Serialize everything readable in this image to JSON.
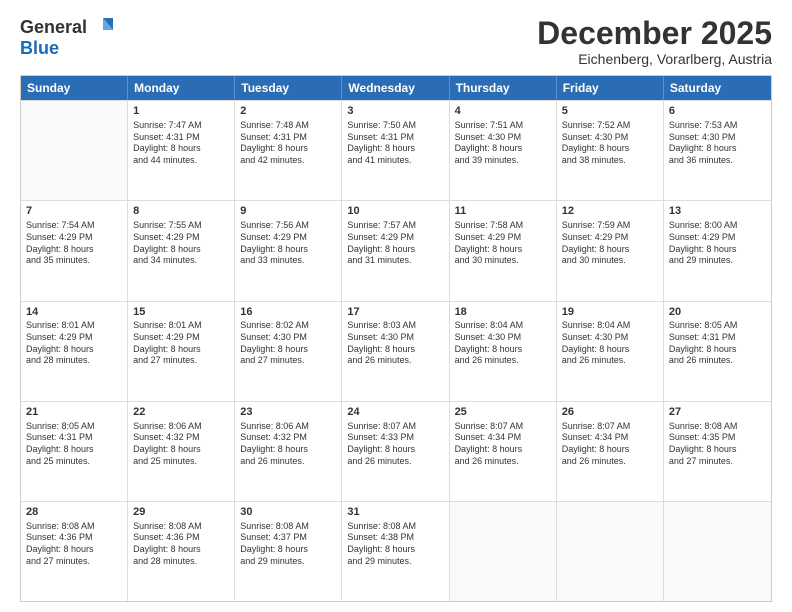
{
  "logo": {
    "general": "General",
    "blue": "Blue"
  },
  "title": "December 2025",
  "subtitle": "Eichenberg, Vorarlberg, Austria",
  "header_days": [
    "Sunday",
    "Monday",
    "Tuesday",
    "Wednesday",
    "Thursday",
    "Friday",
    "Saturday"
  ],
  "weeks": [
    [
      {
        "day": "",
        "lines": []
      },
      {
        "day": "1",
        "lines": [
          "Sunrise: 7:47 AM",
          "Sunset: 4:31 PM",
          "Daylight: 8 hours",
          "and 44 minutes."
        ]
      },
      {
        "day": "2",
        "lines": [
          "Sunrise: 7:48 AM",
          "Sunset: 4:31 PM",
          "Daylight: 8 hours",
          "and 42 minutes."
        ]
      },
      {
        "day": "3",
        "lines": [
          "Sunrise: 7:50 AM",
          "Sunset: 4:31 PM",
          "Daylight: 8 hours",
          "and 41 minutes."
        ]
      },
      {
        "day": "4",
        "lines": [
          "Sunrise: 7:51 AM",
          "Sunset: 4:30 PM",
          "Daylight: 8 hours",
          "and 39 minutes."
        ]
      },
      {
        "day": "5",
        "lines": [
          "Sunrise: 7:52 AM",
          "Sunset: 4:30 PM",
          "Daylight: 8 hours",
          "and 38 minutes."
        ]
      },
      {
        "day": "6",
        "lines": [
          "Sunrise: 7:53 AM",
          "Sunset: 4:30 PM",
          "Daylight: 8 hours",
          "and 36 minutes."
        ]
      }
    ],
    [
      {
        "day": "7",
        "lines": [
          "Sunrise: 7:54 AM",
          "Sunset: 4:29 PM",
          "Daylight: 8 hours",
          "and 35 minutes."
        ]
      },
      {
        "day": "8",
        "lines": [
          "Sunrise: 7:55 AM",
          "Sunset: 4:29 PM",
          "Daylight: 8 hours",
          "and 34 minutes."
        ]
      },
      {
        "day": "9",
        "lines": [
          "Sunrise: 7:56 AM",
          "Sunset: 4:29 PM",
          "Daylight: 8 hours",
          "and 33 minutes."
        ]
      },
      {
        "day": "10",
        "lines": [
          "Sunrise: 7:57 AM",
          "Sunset: 4:29 PM",
          "Daylight: 8 hours",
          "and 31 minutes."
        ]
      },
      {
        "day": "11",
        "lines": [
          "Sunrise: 7:58 AM",
          "Sunset: 4:29 PM",
          "Daylight: 8 hours",
          "and 30 minutes."
        ]
      },
      {
        "day": "12",
        "lines": [
          "Sunrise: 7:59 AM",
          "Sunset: 4:29 PM",
          "Daylight: 8 hours",
          "and 30 minutes."
        ]
      },
      {
        "day": "13",
        "lines": [
          "Sunrise: 8:00 AM",
          "Sunset: 4:29 PM",
          "Daylight: 8 hours",
          "and 29 minutes."
        ]
      }
    ],
    [
      {
        "day": "14",
        "lines": [
          "Sunrise: 8:01 AM",
          "Sunset: 4:29 PM",
          "Daylight: 8 hours",
          "and 28 minutes."
        ]
      },
      {
        "day": "15",
        "lines": [
          "Sunrise: 8:01 AM",
          "Sunset: 4:29 PM",
          "Daylight: 8 hours",
          "and 27 minutes."
        ]
      },
      {
        "day": "16",
        "lines": [
          "Sunrise: 8:02 AM",
          "Sunset: 4:30 PM",
          "Daylight: 8 hours",
          "and 27 minutes."
        ]
      },
      {
        "day": "17",
        "lines": [
          "Sunrise: 8:03 AM",
          "Sunset: 4:30 PM",
          "Daylight: 8 hours",
          "and 26 minutes."
        ]
      },
      {
        "day": "18",
        "lines": [
          "Sunrise: 8:04 AM",
          "Sunset: 4:30 PM",
          "Daylight: 8 hours",
          "and 26 minutes."
        ]
      },
      {
        "day": "19",
        "lines": [
          "Sunrise: 8:04 AM",
          "Sunset: 4:30 PM",
          "Daylight: 8 hours",
          "and 26 minutes."
        ]
      },
      {
        "day": "20",
        "lines": [
          "Sunrise: 8:05 AM",
          "Sunset: 4:31 PM",
          "Daylight: 8 hours",
          "and 26 minutes."
        ]
      }
    ],
    [
      {
        "day": "21",
        "lines": [
          "Sunrise: 8:05 AM",
          "Sunset: 4:31 PM",
          "Daylight: 8 hours",
          "and 25 minutes."
        ]
      },
      {
        "day": "22",
        "lines": [
          "Sunrise: 8:06 AM",
          "Sunset: 4:32 PM",
          "Daylight: 8 hours",
          "and 25 minutes."
        ]
      },
      {
        "day": "23",
        "lines": [
          "Sunrise: 8:06 AM",
          "Sunset: 4:32 PM",
          "Daylight: 8 hours",
          "and 26 minutes."
        ]
      },
      {
        "day": "24",
        "lines": [
          "Sunrise: 8:07 AM",
          "Sunset: 4:33 PM",
          "Daylight: 8 hours",
          "and 26 minutes."
        ]
      },
      {
        "day": "25",
        "lines": [
          "Sunrise: 8:07 AM",
          "Sunset: 4:34 PM",
          "Daylight: 8 hours",
          "and 26 minutes."
        ]
      },
      {
        "day": "26",
        "lines": [
          "Sunrise: 8:07 AM",
          "Sunset: 4:34 PM",
          "Daylight: 8 hours",
          "and 26 minutes."
        ]
      },
      {
        "day": "27",
        "lines": [
          "Sunrise: 8:08 AM",
          "Sunset: 4:35 PM",
          "Daylight: 8 hours",
          "and 27 minutes."
        ]
      }
    ],
    [
      {
        "day": "28",
        "lines": [
          "Sunrise: 8:08 AM",
          "Sunset: 4:36 PM",
          "Daylight: 8 hours",
          "and 27 minutes."
        ]
      },
      {
        "day": "29",
        "lines": [
          "Sunrise: 8:08 AM",
          "Sunset: 4:36 PM",
          "Daylight: 8 hours",
          "and 28 minutes."
        ]
      },
      {
        "day": "30",
        "lines": [
          "Sunrise: 8:08 AM",
          "Sunset: 4:37 PM",
          "Daylight: 8 hours",
          "and 29 minutes."
        ]
      },
      {
        "day": "31",
        "lines": [
          "Sunrise: 8:08 AM",
          "Sunset: 4:38 PM",
          "Daylight: 8 hours",
          "and 29 minutes."
        ]
      },
      {
        "day": "",
        "lines": []
      },
      {
        "day": "",
        "lines": []
      },
      {
        "day": "",
        "lines": []
      }
    ]
  ]
}
